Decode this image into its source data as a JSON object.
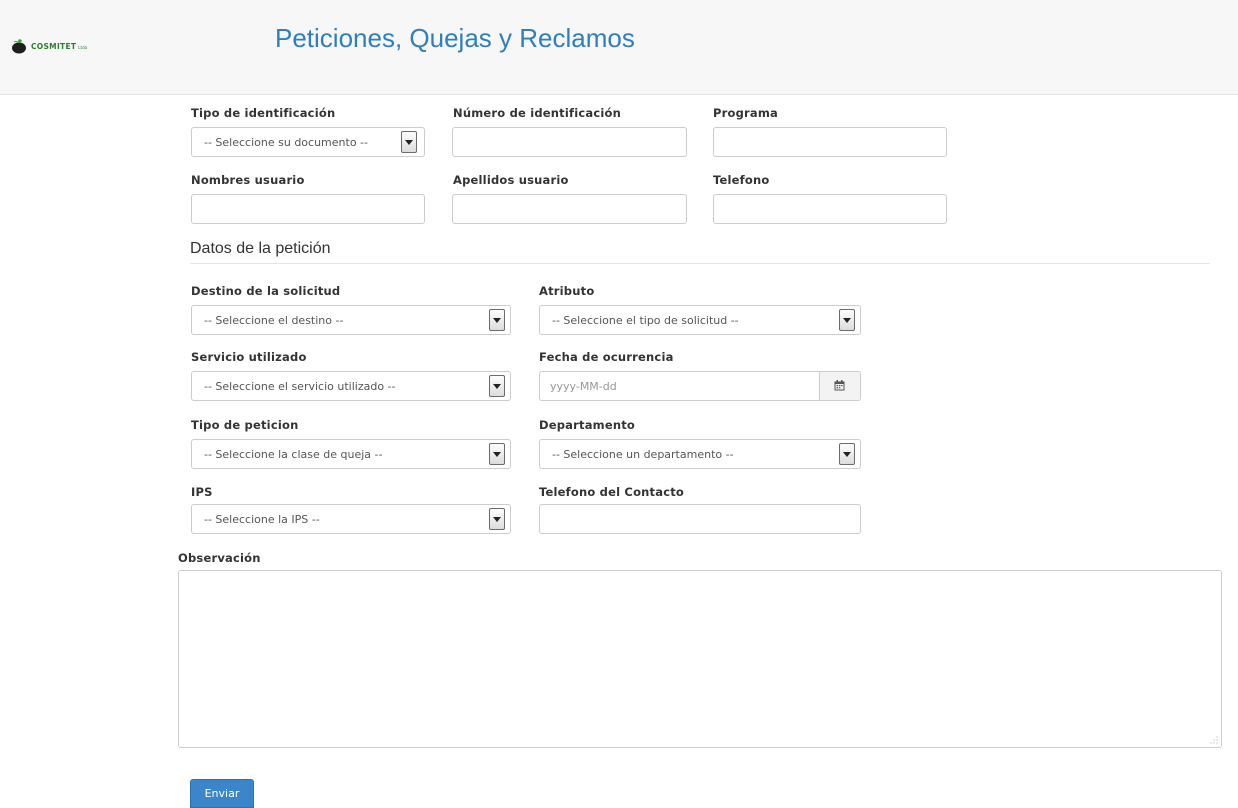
{
  "header": {
    "logo_text": "COSMITET",
    "logo_suffix": "Ltda",
    "title": "Peticiones, Quejas y Reclamos"
  },
  "user_section": {
    "id_type": {
      "label": "Tipo de identificación",
      "selected": "-- Seleccione su documento --"
    },
    "id_number": {
      "label": "Número de identificación",
      "value": ""
    },
    "program": {
      "label": "Programa",
      "value": ""
    },
    "first_names": {
      "label": "Nombres usuario",
      "value": ""
    },
    "last_names": {
      "label": "Apellidos usuario",
      "value": ""
    },
    "phone": {
      "label": "Telefono",
      "value": ""
    }
  },
  "request_section": {
    "title": "Datos de la petición",
    "destination": {
      "label": "Destino de la solicitud",
      "selected": "-- Seleccione el destino --"
    },
    "attribute": {
      "label": "Atributo",
      "selected": "-- Seleccione el tipo de solicitud --"
    },
    "service": {
      "label": "Servicio utilizado",
      "selected": "-- Seleccione el servicio utilizado --"
    },
    "date": {
      "label": "Fecha de ocurrencia",
      "placeholder": "yyyy-MM-dd",
      "icon": "calendar-icon"
    },
    "request_type": {
      "label": "Tipo de peticion",
      "selected": "-- Seleccione la clase de queja --"
    },
    "department": {
      "label": "Departamento",
      "selected": "-- Seleccione un departamento --"
    },
    "ips": {
      "label": "IPS",
      "selected": "-- Seleccione la IPS --"
    },
    "contact_phone": {
      "label": "Telefono del Contacto",
      "value": ""
    }
  },
  "observation": {
    "label": "Observación",
    "value": ""
  },
  "submit": {
    "label": "Enviar"
  },
  "colors": {
    "title_blue": "#2e7fbf",
    "button_blue": "#3a86c8",
    "logo_green": "#2f7d32",
    "border": "#cccccc"
  }
}
